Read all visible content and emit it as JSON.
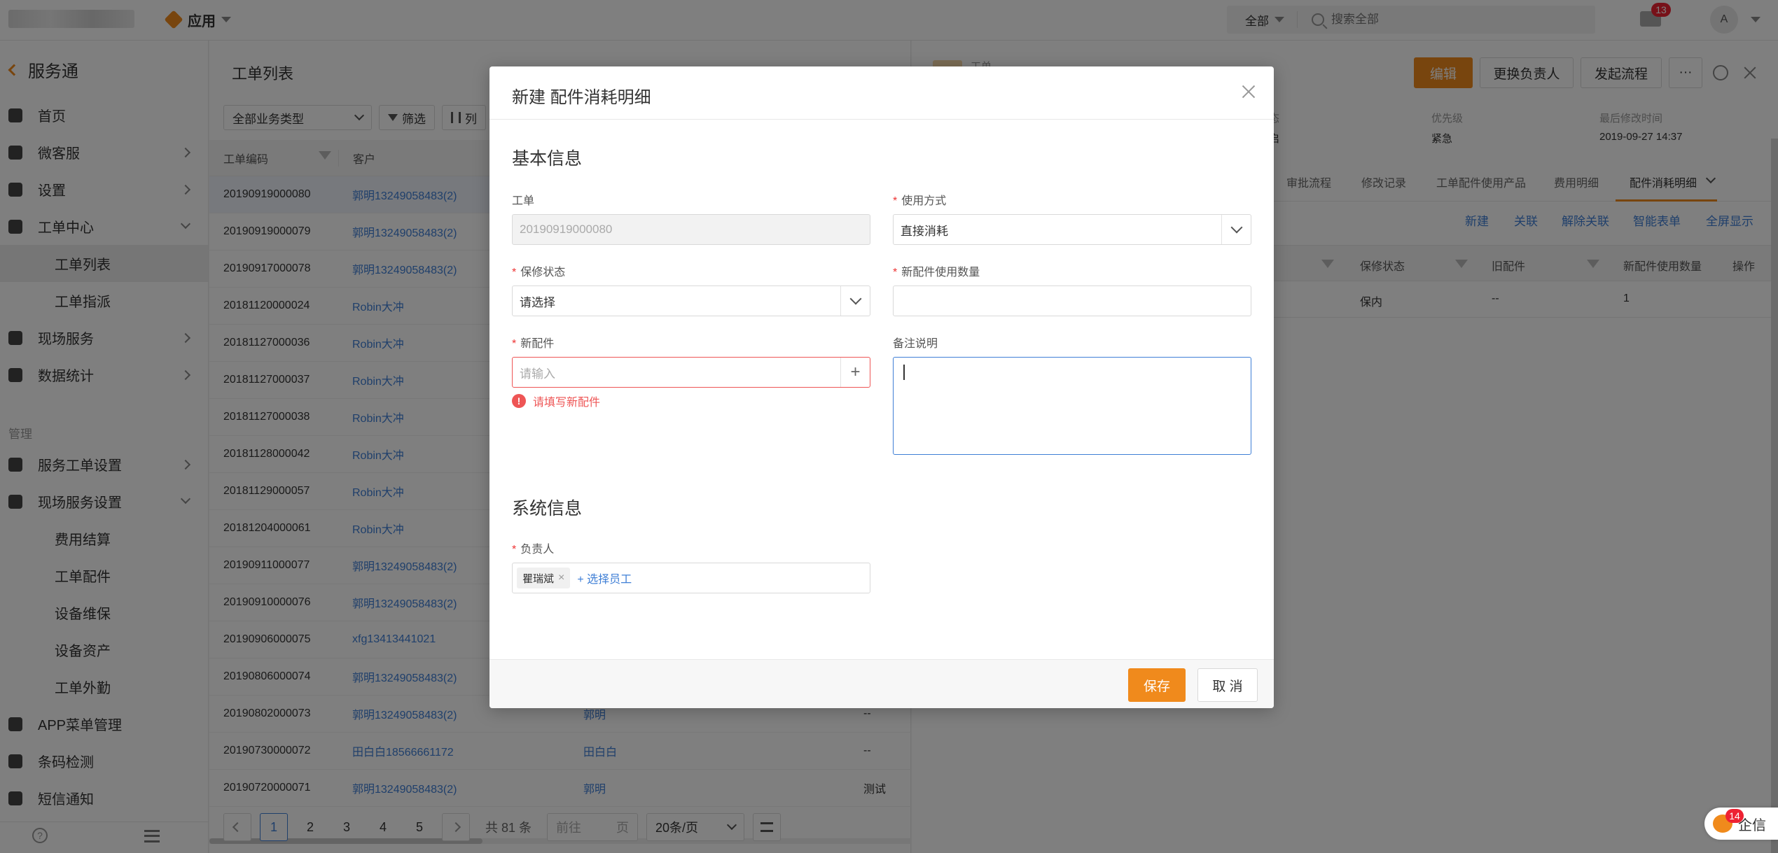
{
  "topbar": {
    "app_label": "应用",
    "search_scope": "全部",
    "search_placeholder": "搜索全部",
    "mail_badge": "13",
    "avatar_text": "A"
  },
  "sidebar": {
    "title": "服务通",
    "items": [
      {
        "label": "首页",
        "icon": "home-icon"
      },
      {
        "label": "微客服",
        "icon": "customer-service-icon"
      },
      {
        "label": "设置",
        "icon": "gear-icon"
      },
      {
        "label": "工单中心",
        "icon": "clipboard-icon"
      }
    ],
    "sub_workorder": [
      "工单列表",
      "工单指派"
    ],
    "items2": [
      {
        "label": "现场服务",
        "icon": "field-service-icon"
      },
      {
        "label": "数据统计",
        "icon": "bar-chart-icon"
      }
    ],
    "section_manage": "管理",
    "items3": [
      {
        "label": "服务工单设置",
        "icon": "workorder-settings-icon"
      },
      {
        "label": "现场服务设置",
        "icon": "field-settings-icon"
      }
    ],
    "sub_field": [
      "费用结算",
      "工单配件",
      "设备维保",
      "设备资产",
      "工单外勤"
    ],
    "items4": [
      {
        "label": "APP菜单管理",
        "icon": "app-menu-icon"
      },
      {
        "label": "条码检测",
        "icon": "barcode-icon"
      },
      {
        "label": "短信通知",
        "icon": "sms-icon"
      }
    ]
  },
  "list": {
    "title": "工单列表",
    "type_select": "全部业务类型",
    "filter_label": "筛选",
    "columns_label": "列",
    "col_code": "工单编码",
    "col_customer": "客户",
    "rows": [
      {
        "code": "20190919000080",
        "customer": "郭明13249058483(2)",
        "person": "",
        "last": ""
      },
      {
        "code": "20190919000079",
        "customer": "郭明13249058483(2)",
        "person": "",
        "last": ""
      },
      {
        "code": "20190917000078",
        "customer": "郭明13249058483(2)",
        "person": "",
        "last": ""
      },
      {
        "code": "20181120000024",
        "customer": "Robin大冲",
        "person": "",
        "last": ""
      },
      {
        "code": "20181127000036",
        "customer": "Robin大冲",
        "person": "",
        "last": ""
      },
      {
        "code": "20181127000037",
        "customer": "Robin大冲",
        "person": "",
        "last": ""
      },
      {
        "code": "20181127000038",
        "customer": "Robin大冲",
        "person": "",
        "last": ""
      },
      {
        "code": "20181128000042",
        "customer": "Robin大冲",
        "person": "",
        "last": ""
      },
      {
        "code": "20181129000057",
        "customer": "Robin大冲",
        "person": "",
        "last": ""
      },
      {
        "code": "20181204000061",
        "customer": "Robin大冲",
        "person": "",
        "last": ""
      },
      {
        "code": "20190911000077",
        "customer": "郭明13249058483(2)",
        "person": "",
        "last": ""
      },
      {
        "code": "20190910000076",
        "customer": "郭明13249058483(2)",
        "person": "",
        "last": ""
      },
      {
        "code": "20190906000075",
        "customer": "xfg13413441021",
        "person": "",
        "last": ""
      },
      {
        "code": "20190806000074",
        "customer": "郭明13249058483(2)",
        "person": "",
        "last": ""
      },
      {
        "code": "20190802000073",
        "customer": "郭明13249058483(2)",
        "person": "郭明",
        "last": "--"
      },
      {
        "code": "20190730000072",
        "customer": "田白白18566661172",
        "person": "田白白",
        "last": "--"
      },
      {
        "code": "20190720000071",
        "customer": "郭明13249058483(2)",
        "person": "郭明",
        "last": "测试"
      }
    ],
    "pager": {
      "pages": [
        "1",
        "2",
        "3",
        "4",
        "5"
      ],
      "total": "共 81 条",
      "goto_placeholder": "前往",
      "goto_suffix": "页",
      "page_size": "20条/页"
    }
  },
  "detail": {
    "small_label": "工单",
    "btn_edit": "编辑",
    "btn_change_owner": "更换负责人",
    "btn_start_flow": "发起流程",
    "btn_more": "···",
    "meta": [
      {
        "key": "态",
        "value": "启"
      },
      {
        "key": "优先级",
        "value": "紧急"
      },
      {
        "key": "最后修改时间",
        "value": "2019-09-27 14:37"
      }
    ],
    "tabs": [
      "审批流程",
      "修改记录",
      "工单配件使用产品",
      "费用明细",
      "配件消耗明细"
    ],
    "actions": [
      "新建",
      "关联",
      "解除关联",
      "智能表单",
      "全屏显示"
    ],
    "columns": [
      "保修状态",
      "旧配件",
      "新配件使用数量",
      "操作"
    ],
    "row": {
      "warranty": "保内",
      "old_part": "--",
      "qty": "1"
    }
  },
  "modal": {
    "title": "新建 配件消耗明细",
    "section_basic": "基本信息",
    "section_system": "系统信息",
    "f_workorder_label": "工单",
    "f_workorder_value": "20190919000080",
    "f_usage_label": "使用方式",
    "f_usage_value": "直接消耗",
    "f_warranty_label": "保修状态",
    "f_warranty_value": "请选择",
    "f_qty_label": "新配件使用数量",
    "f_qty_value": "",
    "f_part_label": "新配件",
    "f_part_placeholder": "请输入",
    "f_part_error": "请填写新配件",
    "f_note_label": "备注说明",
    "f_note_value": "",
    "f_owner_label": "负责人",
    "f_owner_tag": "瞿瑞斌",
    "f_owner_add": "+ 选择员工",
    "btn_save": "保存",
    "btn_cancel": "取 消"
  },
  "chat": {
    "label": "企信",
    "badge": "14"
  },
  "colors": {
    "accent": "#f08a1c",
    "link": "#3f7fd6",
    "error": "#e55555"
  }
}
